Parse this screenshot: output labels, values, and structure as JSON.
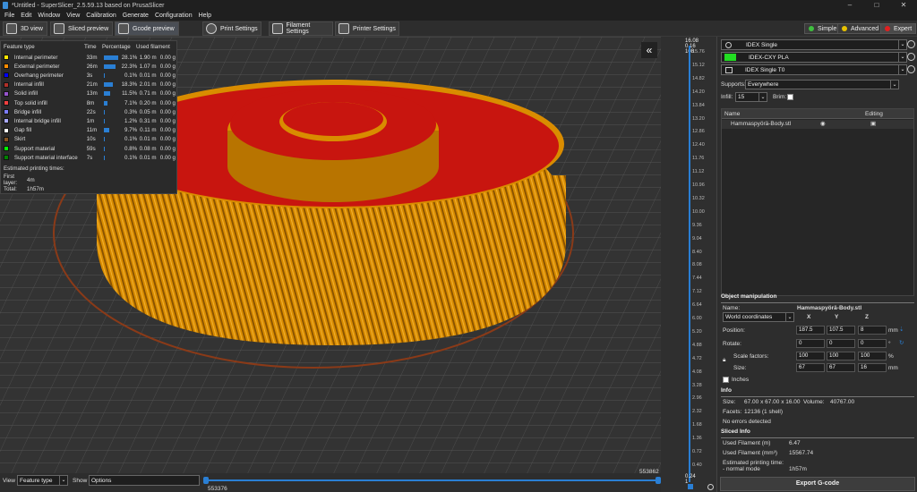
{
  "title": "*Untitled - SuperSlicer_2.5.59.13  based on PrusaSlicer",
  "menu": [
    "File",
    "Edit",
    "Window",
    "View",
    "Calibration",
    "Generate",
    "Configuration",
    "Help"
  ],
  "tabs": {
    "view3d": "3D view",
    "sliced": "Sliced preview",
    "gcode": "Gcode preview",
    "print": "Print Settings",
    "filament": "Filament Settings",
    "printer": "Printer Settings"
  },
  "modes": {
    "simple": "Simple",
    "advanced": "Advanced",
    "expert": "Expert"
  },
  "legend": {
    "headers": {
      "type": "Feature type",
      "time": "Time",
      "pct": "Percentage",
      "used": "Used filament"
    },
    "rows": [
      {
        "name": "Internal perimeter",
        "time": "33m",
        "pct": "28.1%",
        "m": "1.90 m",
        "g": "0.00 g",
        "color": "#ffe600",
        "bar": 0.28
      },
      {
        "name": "External perimeter",
        "time": "26m",
        "pct": "22.3%",
        "m": "1.07 m",
        "g": "0.00 g",
        "color": "#ff8c00",
        "bar": 0.22
      },
      {
        "name": "Overhang perimeter",
        "time": "3s",
        "pct": "0.1%",
        "m": "0.01 m",
        "g": "0.00 g",
        "color": "#0000ff",
        "bar": 0.01
      },
      {
        "name": "Internal infill",
        "time": "21m",
        "pct": "18.3%",
        "m": "2.01 m",
        "g": "0.00 g",
        "color": "#b03029",
        "bar": 0.18
      },
      {
        "name": "Solid infill",
        "time": "13m",
        "pct": "11.5%",
        "m": "0.71 m",
        "g": "0.00 g",
        "color": "#9654cc",
        "bar": 0.12
      },
      {
        "name": "Top solid infill",
        "time": "8m",
        "pct": "7.1%",
        "m": "0.20 m",
        "g": "0.00 g",
        "color": "#f04040",
        "bar": 0.07
      },
      {
        "name": "Bridge infill",
        "time": "22s",
        "pct": "0.3%",
        "m": "0.05 m",
        "g": "0.00 g",
        "color": "#7d7dff",
        "bar": 0.01
      },
      {
        "name": "Internal bridge infill",
        "time": "1m",
        "pct": "1.2%",
        "m": "0.31 m",
        "g": "0.00 g",
        "color": "#aaaaff",
        "bar": 0.02
      },
      {
        "name": "Gap fill",
        "time": "11m",
        "pct": "9.7%",
        "m": "0.11 m",
        "g": "0.00 g",
        "color": "#ffffff",
        "bar": 0.1
      },
      {
        "name": "Skirt",
        "time": "10s",
        "pct": "0.1%",
        "m": "0.01 m",
        "g": "0.00 g",
        "color": "#845321",
        "bar": 0.01
      },
      {
        "name": "Support material",
        "time": "59s",
        "pct": "0.8%",
        "m": "0.08 m",
        "g": "0.00 g",
        "color": "#00ff00",
        "bar": 0.01
      },
      {
        "name": "Support material interface",
        "time": "7s",
        "pct": "0.1%",
        "m": "0.01 m",
        "g": "0.00 g",
        "color": "#008000",
        "bar": 0.01
      }
    ],
    "est_label": "Estimated printing times:",
    "first_layer_label": "First layer:",
    "first_layer": "4m",
    "total_label": "Total:",
    "total": "1h57m"
  },
  "vslider": {
    "top": "16.08",
    "top2": "0.16",
    "top3": "108",
    "ticks": [
      "15.76",
      "15.12",
      "14.82",
      "14.20",
      "13.84",
      "13.20",
      "12.86",
      "12.40",
      "11.76",
      "11.12",
      "10.96",
      "10.32",
      "10.00",
      "9.36",
      "9.04",
      "8.40",
      "8.08",
      "7.44",
      "7.12",
      "6.64",
      "6.00",
      "5.20",
      "4.88",
      "4.72",
      "4.08",
      "3.28",
      "2.96",
      "2.32",
      "1.68",
      "1.36",
      "0.72",
      "0.40"
    ],
    "bottom": "0.24",
    "bottom2": "1"
  },
  "right": {
    "printer": "IDEX Single",
    "filament": "IDEX-CXY PLA",
    "print": "IDEX Single T0",
    "supports_label": "Supports:",
    "supports": "Everywhere",
    "infill_label": "Infill:",
    "infill": "15",
    "brim_label": "Brim:",
    "col_name": "Name",
    "col_editing": "Editing",
    "object": "Hammaspyörä-Body.stl",
    "om_header": "Object manipulation",
    "name_label": "Name:",
    "name_value": "Hammaspyörä-Body.stl",
    "coords": "World coordinates",
    "x": "X",
    "y": "Y",
    "z": "Z",
    "position_label": "Position:",
    "pos": [
      "187.5",
      "107.5",
      "8"
    ],
    "pos_unit": "mm",
    "rotate_label": "Rotate:",
    "rot": [
      "0",
      "0",
      "0"
    ],
    "rot_unit": "°",
    "scale_label": "Scale factors:",
    "scale": [
      "100",
      "100",
      "100"
    ],
    "scale_unit": "%",
    "size_label": "Size:",
    "size": [
      "67",
      "67",
      "16"
    ],
    "size_unit": "mm",
    "inches": "Inches",
    "info_header": "Info",
    "info_size_label": "Size:",
    "info_size": "67.00 x 67.00 x 16.00",
    "info_volume_label": "Volume:",
    "info_volume": "40767.00",
    "facets_label": "Facets:",
    "facets": "12136 (1 shell)",
    "errors": "No errors detected",
    "sliced_header": "Sliced Info",
    "used_m_label": "Used Filament (m)",
    "used_m": "6.47",
    "used_mm3_label": "Used Filament (mm³)",
    "used_mm3": "15567.74",
    "est_label": "Estimated printing time:",
    "normal_label": "- normal mode",
    "normal": "1h57m",
    "export": "Export G-code"
  },
  "bottom": {
    "view_label": "View",
    "view": "Feature type",
    "show_label": "Show",
    "show": "Options",
    "left_val": "553376",
    "right_val": "553862"
  },
  "colors": {
    "bg": "#333333",
    "gear_red": "#c8150f",
    "gear_orange": "#d98c00",
    "accent": "#2a7fd4"
  }
}
